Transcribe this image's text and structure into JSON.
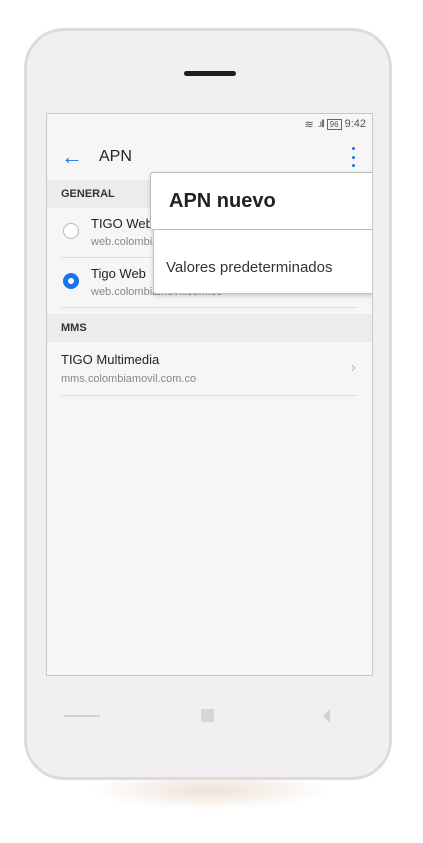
{
  "status_bar": {
    "wifi_icon": "wifi-icon",
    "signal_icon": "signal-icon",
    "battery": "96",
    "time": "9:42"
  },
  "toolbar": {
    "back_icon": "arrow-left-icon",
    "title": "APN",
    "menu_icon": "more-vertical-icon"
  },
  "sections": {
    "general": "GENERAL",
    "mms": "MMS"
  },
  "apn_list": [
    {
      "name": "TIGO Web",
      "url": "web.colombiamovil.com.co",
      "selected": false
    },
    {
      "name": "Tigo Web",
      "url": "web.colombiamovil.com.co",
      "selected": true
    }
  ],
  "mms_list": [
    {
      "name": "TIGO Multimedia",
      "url": "mms.colombiamovil.com.co"
    }
  ],
  "menu": {
    "new_apn": "APN nuevo",
    "defaults": "Valores predeterminados"
  },
  "colors": {
    "accent": "#1a73e8"
  }
}
